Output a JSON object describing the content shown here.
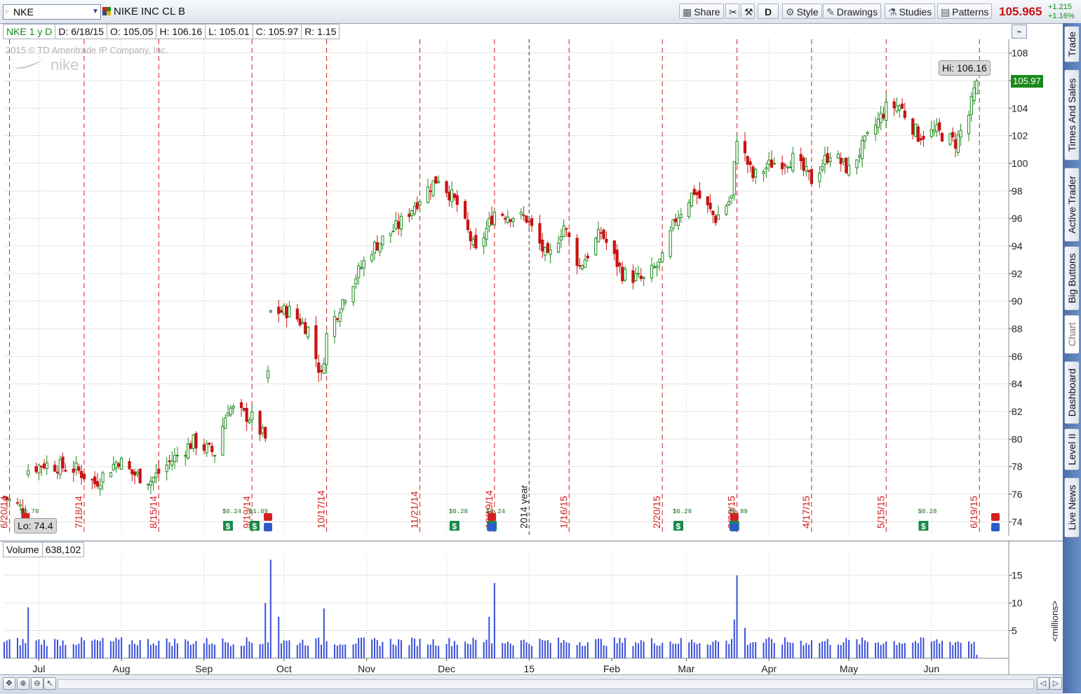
{
  "toolbar": {
    "symbol": "NKE",
    "company": "NIKE INC CL B",
    "share_label": "Share",
    "aggregation_label": "D",
    "style_label": "Style",
    "drawings_label": "Drawings",
    "studies_label": "Studies",
    "patterns_label": "Patterns",
    "last_price": "105.965",
    "net_change": "+1.215",
    "pct_change": "+1.16%"
  },
  "infobar": {
    "symbol_period": "NKE 1 y D",
    "date": "D: 6/18/15",
    "open": "O: 105.05",
    "high": "H: 106.16",
    "low": "L: 105.01",
    "close": "C: 105.97",
    "range": "R: 1.15"
  },
  "watermark": "2015 © TD Ameritrade IP Company, Inc.",
  "brand": "nike",
  "hi_label": "Hi: 106.16",
  "lo_label": "Lo: 74.4",
  "last_tag": "105.97",
  "volume_panel": {
    "label": "Volume",
    "value": "638,102",
    "unit_label": "<millions>"
  },
  "sidebar": {
    "tabs": [
      "Trade",
      "Times And Sales",
      "Active Trader",
      "Big Buttons",
      "Chart",
      "Dashboard",
      "Level II",
      "Live News"
    ]
  },
  "colors": {
    "up": "#1a8a1a",
    "down": "#c81414",
    "volume": "#3a50d8",
    "grid": "#b8b8b8",
    "event_line": "#d42020"
  },
  "chart_data": {
    "type": "candlestick",
    "title": "NIKE INC CL B",
    "symbol": "NKE",
    "period": "1 y D",
    "y_ticks": [
      74,
      76,
      78,
      80,
      82,
      84,
      86,
      88,
      90,
      92,
      94,
      96,
      98,
      100,
      102,
      104,
      106,
      108
    ],
    "ylim": [
      73,
      109
    ],
    "x_range": [
      "2014-06-18",
      "2015-06-30"
    ],
    "month_labels": [
      {
        "date": "2014-07-01",
        "label": "Jul"
      },
      {
        "date": "2014-08-01",
        "label": "Aug"
      },
      {
        "date": "2014-09-01",
        "label": "Sep"
      },
      {
        "date": "2014-10-01",
        "label": "Oct"
      },
      {
        "date": "2014-11-01",
        "label": "Nov"
      },
      {
        "date": "2014-12-01",
        "label": "Dec"
      },
      {
        "date": "2015-01-01",
        "label": "15"
      },
      {
        "date": "2015-02-01",
        "label": "Feb"
      },
      {
        "date": "2015-03-01",
        "label": "Mar"
      },
      {
        "date": "2015-04-01",
        "label": "Apr"
      },
      {
        "date": "2015-05-01",
        "label": "May"
      },
      {
        "date": "2015-06-01",
        "label": "Jun"
      }
    ],
    "expiration_lines": [
      {
        "date": "2014-06-20",
        "label": "6/20/14"
      },
      {
        "date": "2014-07-18",
        "label": "7/18/14"
      },
      {
        "date": "2014-08-15",
        "label": "8/15/14"
      },
      {
        "date": "2014-09-19",
        "label": "9/19/14"
      },
      {
        "date": "2014-10-17",
        "label": "10/17/14"
      },
      {
        "date": "2014-11-21",
        "label": "11/21/14"
      },
      {
        "date": "2014-12-19",
        "label": "12/19/14"
      },
      {
        "date": "2015-01-16",
        "label": "1/16/15"
      },
      {
        "date": "2015-02-20",
        "label": "2/20/15"
      },
      {
        "date": "2015-03-20",
        "label": "3/20/15"
      },
      {
        "date": "2015-04-17",
        "label": "4/17/15"
      },
      {
        "date": "2015-05-15",
        "label": "5/15/15"
      },
      {
        "date": "2015-06-19",
        "label": "6/19/15"
      }
    ],
    "year_line": {
      "date": "2015-01-01",
      "label": "2014 year"
    },
    "dividends": [
      {
        "date": "2014-06-26",
        "label": "$0.78"
      },
      {
        "date": "2014-09-10",
        "label": "$0.24"
      },
      {
        "date": "2014-09-20",
        "label": "$1.09"
      },
      {
        "date": "2014-12-04",
        "label": "$0.28"
      },
      {
        "date": "2014-12-18",
        "label": "$0.24"
      },
      {
        "date": "2015-02-26",
        "label": "$0.28"
      },
      {
        "date": "2015-03-19",
        "label": "$0.89"
      },
      {
        "date": "2015-05-29",
        "label": "$0.28"
      }
    ],
    "earnings": [
      "2014-06-26",
      "2014-09-25",
      "2014-12-18",
      "2015-03-19",
      "2015-06-25"
    ],
    "anchors": [
      [
        "2014-06-18",
        75.8
      ],
      [
        "2014-06-26",
        74.8
      ],
      [
        "2014-06-27",
        77.8
      ],
      [
        "2014-07-03",
        78.2
      ],
      [
        "2014-07-15",
        77.8
      ],
      [
        "2014-07-22",
        76.8
      ],
      [
        "2014-07-31",
        78.5
      ],
      [
        "2014-08-05",
        77.5
      ],
      [
        "2014-08-12",
        77.0
      ],
      [
        "2014-08-20",
        78.5
      ],
      [
        "2014-08-28",
        79.8
      ],
      [
        "2014-09-05",
        79.0
      ],
      [
        "2014-09-10",
        82.3
      ],
      [
        "2014-09-19",
        81.5
      ],
      [
        "2014-09-24",
        80.0
      ],
      [
        "2014-09-26",
        89.2
      ],
      [
        "2014-10-03",
        89.3
      ],
      [
        "2014-10-10",
        88.0
      ],
      [
        "2014-10-15",
        84.5
      ],
      [
        "2014-10-17",
        87.5
      ],
      [
        "2014-10-24",
        90.5
      ],
      [
        "2014-11-03",
        93.8
      ],
      [
        "2014-11-13",
        95.5
      ],
      [
        "2014-11-21",
        97.5
      ],
      [
        "2014-11-28",
        99.0
      ],
      [
        "2014-12-05",
        97.0
      ],
      [
        "2014-12-12",
        93.5
      ],
      [
        "2014-12-19",
        96.5
      ],
      [
        "2014-12-31",
        96.0
      ],
      [
        "2015-01-08",
        93.0
      ],
      [
        "2015-01-14",
        95.5
      ],
      [
        "2015-01-20",
        92.5
      ],
      [
        "2015-01-28",
        95.0
      ],
      [
        "2015-02-05",
        92.0
      ],
      [
        "2015-02-13",
        91.5
      ],
      [
        "2015-02-20",
        93.0
      ],
      [
        "2015-02-25",
        96.0
      ],
      [
        "2015-03-04",
        98.0
      ],
      [
        "2015-03-12",
        96.0
      ],
      [
        "2015-03-18",
        97.5
      ],
      [
        "2015-03-20",
        102.0
      ],
      [
        "2015-03-26",
        99.0
      ],
      [
        "2015-04-02",
        100.0
      ],
      [
        "2015-04-10",
        100.3
      ],
      [
        "2015-04-17",
        98.8
      ],
      [
        "2015-04-24",
        100.8
      ],
      [
        "2015-05-01",
        99.5
      ],
      [
        "2015-05-08",
        101.8
      ],
      [
        "2015-05-15",
        104.0
      ],
      [
        "2015-05-20",
        104.2
      ],
      [
        "2015-05-27",
        102.0
      ],
      [
        "2015-06-03",
        102.3
      ],
      [
        "2015-06-10",
        101.5
      ],
      [
        "2015-06-15",
        103.5
      ],
      [
        "2015-06-18",
        105.97
      ]
    ],
    "volume_ticks": [
      5,
      10,
      15
    ],
    "volume_ylim": [
      0,
      18
    ],
    "volume_unit": "millions",
    "volume_spikes": [
      [
        "2014-06-27",
        9.2
      ],
      [
        "2014-09-24",
        10.0
      ],
      [
        "2014-09-26",
        17.8
      ],
      [
        "2014-09-29",
        7.5
      ],
      [
        "2014-10-16",
        9.0
      ],
      [
        "2014-12-17",
        7.5
      ],
      [
        "2014-12-19",
        13.6
      ],
      [
        "2015-03-19",
        7.0
      ],
      [
        "2015-03-20",
        15.0
      ],
      [
        "2015-03-23",
        5.5
      ]
    ]
  }
}
